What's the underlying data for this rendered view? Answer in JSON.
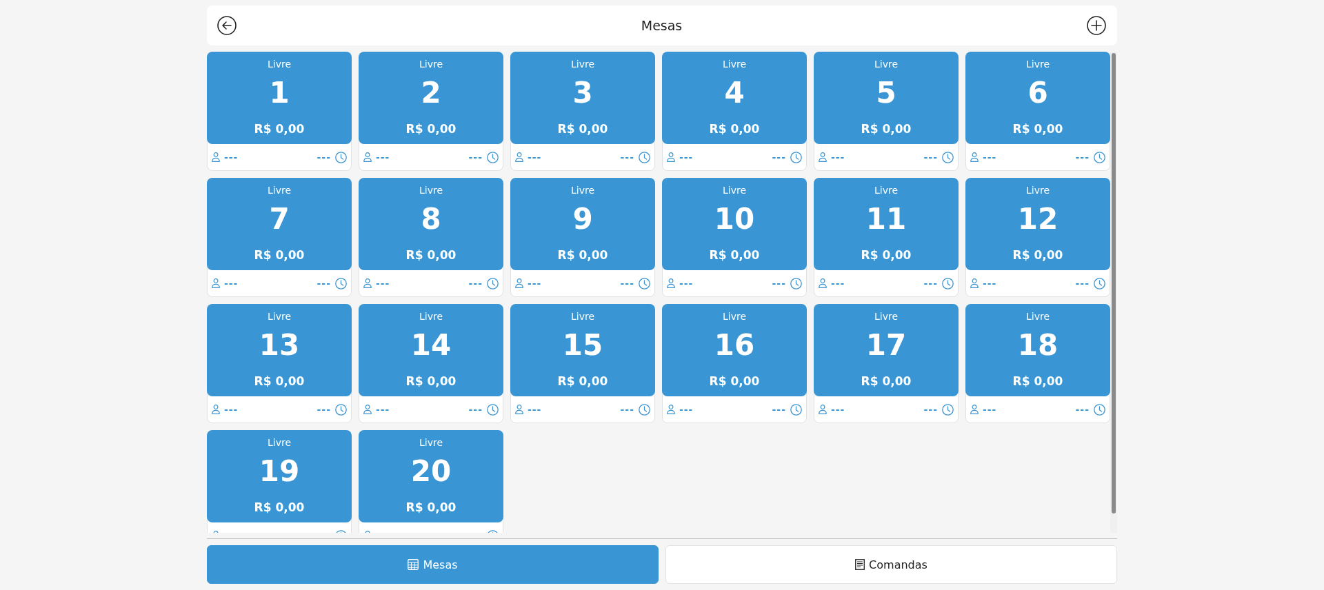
{
  "header": {
    "title": "Mesas"
  },
  "tables": [
    {
      "status": "Livre",
      "number": "1",
      "total": "R$ 0,00",
      "customer": "---",
      "time": "---"
    },
    {
      "status": "Livre",
      "number": "2",
      "total": "R$ 0,00",
      "customer": "---",
      "time": "---"
    },
    {
      "status": "Livre",
      "number": "3",
      "total": "R$ 0,00",
      "customer": "---",
      "time": "---"
    },
    {
      "status": "Livre",
      "number": "4",
      "total": "R$ 0,00",
      "customer": "---",
      "time": "---"
    },
    {
      "status": "Livre",
      "number": "5",
      "total": "R$ 0,00",
      "customer": "---",
      "time": "---"
    },
    {
      "status": "Livre",
      "number": "6",
      "total": "R$ 0,00",
      "customer": "---",
      "time": "---"
    },
    {
      "status": "Livre",
      "number": "7",
      "total": "R$ 0,00",
      "customer": "---",
      "time": "---"
    },
    {
      "status": "Livre",
      "number": "8",
      "total": "R$ 0,00",
      "customer": "---",
      "time": "---"
    },
    {
      "status": "Livre",
      "number": "9",
      "total": "R$ 0,00",
      "customer": "---",
      "time": "---"
    },
    {
      "status": "Livre",
      "number": "10",
      "total": "R$ 0,00",
      "customer": "---",
      "time": "---"
    },
    {
      "status": "Livre",
      "number": "11",
      "total": "R$ 0,00",
      "customer": "---",
      "time": "---"
    },
    {
      "status": "Livre",
      "number": "12",
      "total": "R$ 0,00",
      "customer": "---",
      "time": "---"
    },
    {
      "status": "Livre",
      "number": "13",
      "total": "R$ 0,00",
      "customer": "---",
      "time": "---"
    },
    {
      "status": "Livre",
      "number": "14",
      "total": "R$ 0,00",
      "customer": "---",
      "time": "---"
    },
    {
      "status": "Livre",
      "number": "15",
      "total": "R$ 0,00",
      "customer": "---",
      "time": "---"
    },
    {
      "status": "Livre",
      "number": "16",
      "total": "R$ 0,00",
      "customer": "---",
      "time": "---"
    },
    {
      "status": "Livre",
      "number": "17",
      "total": "R$ 0,00",
      "customer": "---",
      "time": "---"
    },
    {
      "status": "Livre",
      "number": "18",
      "total": "R$ 0,00",
      "customer": "---",
      "time": "---"
    },
    {
      "status": "Livre",
      "number": "19",
      "total": "R$ 0,00"
    },
    {
      "status": "Livre",
      "number": "20",
      "total": "R$ 0,00"
    }
  ],
  "tabs": [
    {
      "label": "Mesas",
      "selected": true
    },
    {
      "label": "Comandas",
      "selected": false
    }
  ]
}
